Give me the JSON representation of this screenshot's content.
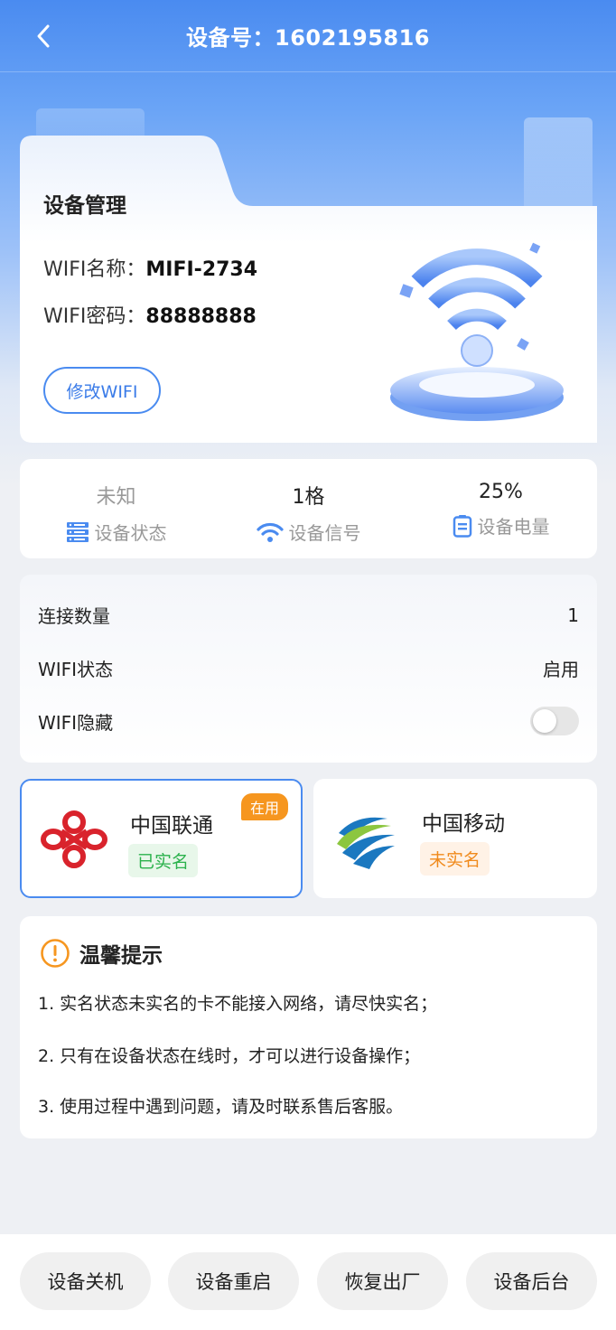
{
  "header": {
    "title": "设备号：1602195816"
  },
  "device": {
    "section_title": "设备管理",
    "wifi_name_label": "WIFI名称：",
    "wifi_name": "MIFI-2734",
    "wifi_password_label": "WIFI密码：",
    "wifi_password": "88888888",
    "modify_button": "修改WIFI"
  },
  "stats": [
    {
      "value": "未知",
      "label": "设备状态",
      "icon": "server-icon"
    },
    {
      "value": "1格",
      "label": "设备信号",
      "icon": "wifi-signal-icon"
    },
    {
      "value": "25%",
      "label": "设备电量",
      "icon": "battery-icon"
    }
  ],
  "info": {
    "connections_label": "连接数量",
    "connections_value": "1",
    "wifi_status_label": "WIFI状态",
    "wifi_status_value": "启用",
    "wifi_hidden_label": "WIFI隐藏",
    "wifi_hidden_on": false
  },
  "sims": [
    {
      "carrier": "中国联通",
      "status": "已实名",
      "in_use_badge": "在用",
      "logo": "china-unicom-logo"
    },
    {
      "carrier": "中国移动",
      "status": "未实名",
      "logo": "china-mobile-logo"
    }
  ],
  "tips": {
    "title": "温馨提示",
    "items": [
      "1. 实名状态未实名的卡不能接入网络，请尽快实名；",
      "2. 只有在设备状态在线时，才可以进行设备操作；",
      "3. 使用过程中遇到问题，请及时联系售后客服。"
    ]
  },
  "actions": [
    "设备关机",
    "设备重启",
    "恢复出厂",
    "设备后台"
  ],
  "colors": {
    "primary": "#4a8bf0",
    "warning": "#f6961f",
    "success": "#2bb24c"
  }
}
